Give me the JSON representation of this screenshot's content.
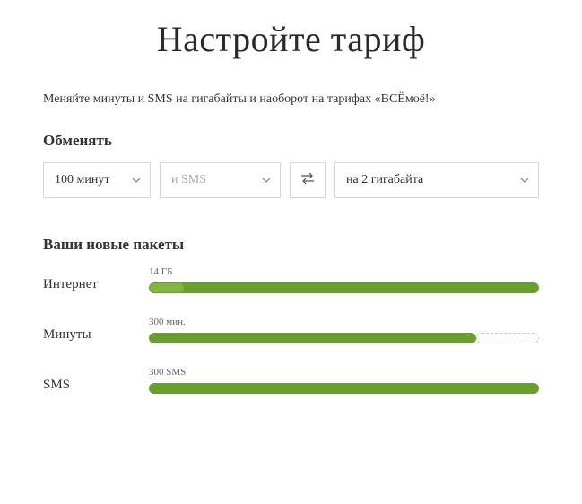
{
  "title": "Настройте тариф",
  "subtitle": "Меняйте минуты и SMS на гигабайты и наоборот на тарифах «ВСЁмоё!»",
  "exchange": {
    "heading": "Обменять",
    "minutes_value": "100 минут",
    "sms_placeholder": "и SMS",
    "target_value": "на 2 гигабайта"
  },
  "packages": {
    "heading": "Ваши новые пакеты",
    "internet": {
      "label": "Интернет",
      "value": "14 ГБ",
      "fill_pct": 100,
      "ghost_pct": 0,
      "knob": true
    },
    "minutes": {
      "label": "Минуты",
      "value": "300 мин.",
      "fill_pct": 84,
      "ghost_pct": 16,
      "knob": false
    },
    "sms": {
      "label": "SMS",
      "value": "300 SMS",
      "fill_pct": 100,
      "ghost_pct": 0,
      "knob": false
    }
  }
}
